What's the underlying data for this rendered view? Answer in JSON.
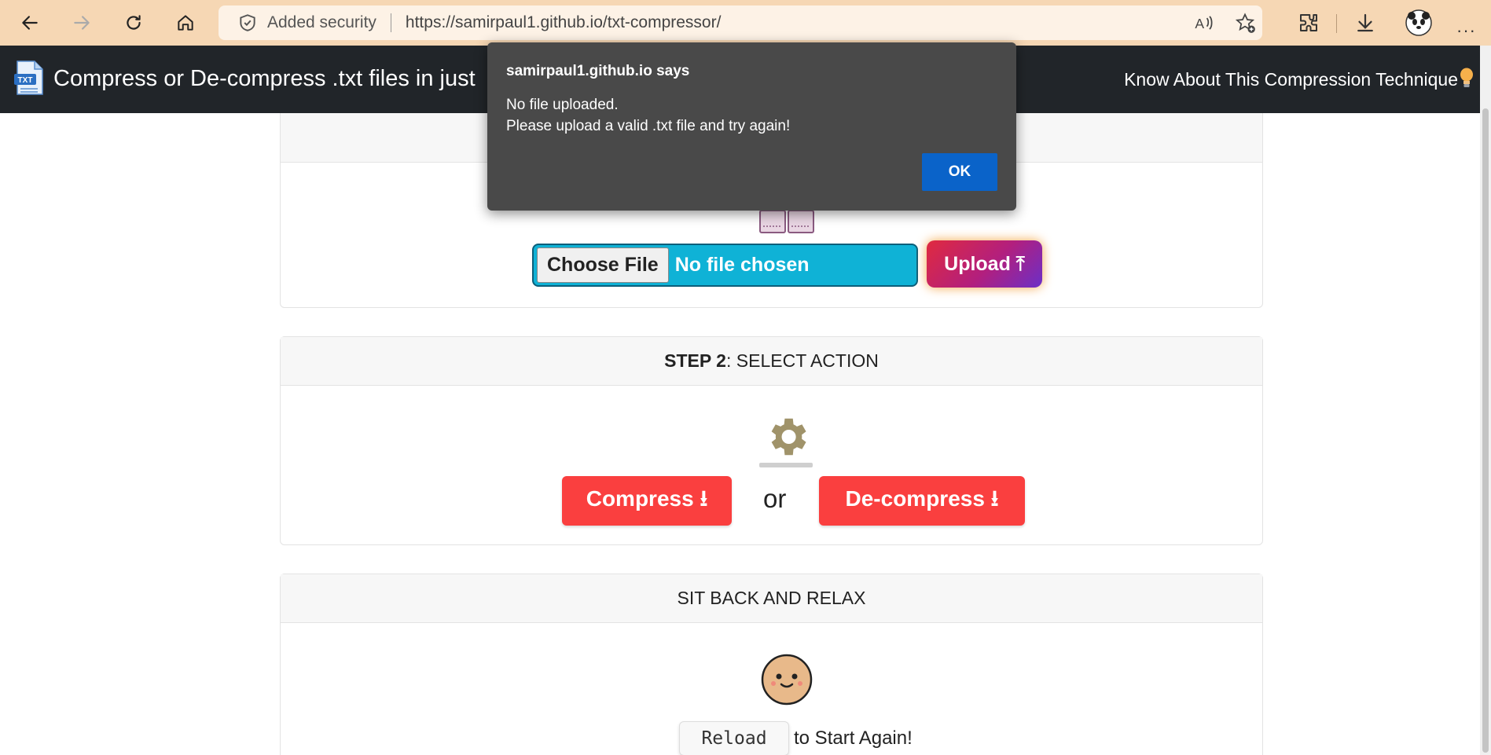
{
  "browser": {
    "security_label": "Added security",
    "url": "https://samirpaul1.github.io/txt-compressor/"
  },
  "navbar": {
    "title": "Compress or De-compress .txt files in just",
    "link": "Know About This Compression Technique"
  },
  "step1": {
    "choose_label": "Choose File",
    "no_file": "No file chosen",
    "upload_label": "Upload ⤒"
  },
  "step2": {
    "header_bold": "STEP 2",
    "header_rest": ": SELECT ACTION",
    "compress_label": "Compress ⭳",
    "or_label": "or",
    "decompress_label": "De-compress ⭳"
  },
  "step3": {
    "header": "SIT BACK AND RELAX",
    "reload_label": "Reload",
    "reload_suffix": "to Start Again!"
  },
  "dialog": {
    "title": "samirpaul1.github.io says",
    "line1": "No file uploaded.",
    "line2": "Please upload a valid .txt file and try again!",
    "ok_label": "OK"
  },
  "colors": {
    "navbar_bg": "#212529",
    "file_input_bg": "#0fb2d6",
    "action_btn": "#fa3f3f",
    "dialog_bg": "#494949",
    "dialog_ok": "#0a63c9"
  }
}
